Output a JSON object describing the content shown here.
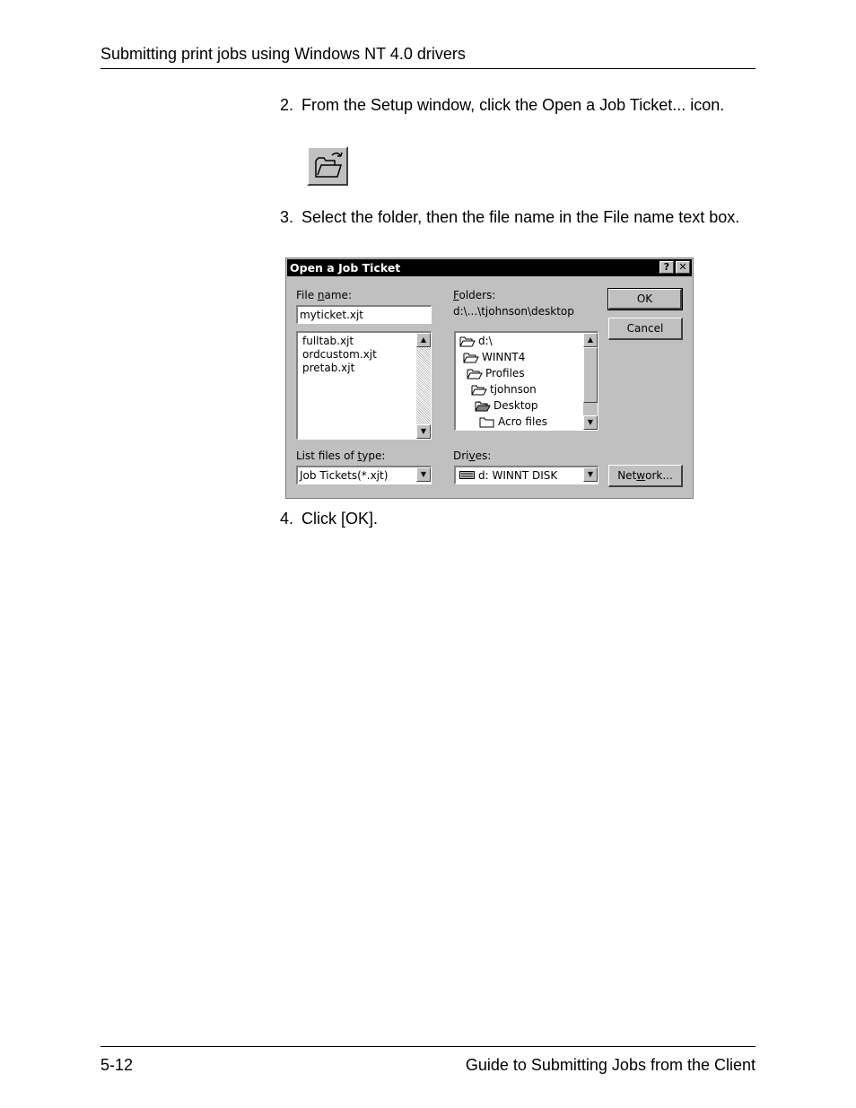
{
  "header": {
    "title": "Submitting print jobs using Windows NT 4.0 drivers"
  },
  "steps": [
    {
      "num": "2.",
      "text": "From the Setup window, click the Open a Job Ticket... icon."
    },
    {
      "num": "3.",
      "text": "Select the folder, then the file name in the File name text box."
    },
    {
      "num": "4.",
      "text": "Click [OK]."
    }
  ],
  "toolbar_icon": {
    "icon": "open-folder-icon"
  },
  "dialog": {
    "title": "Open a Job Ticket",
    "help_btn": "?",
    "close_btn": "✕",
    "file_name_label_pre": "File ",
    "file_name_label_u": "n",
    "file_name_label_post": "ame:",
    "file_name_value": "myticket.xjt",
    "files": [
      "fulltab.xjt",
      "ordcustom.xjt",
      "pretab.xjt"
    ],
    "folders_label_u": "F",
    "folders_label_post": "olders:",
    "current_path": "d:\\...\\tjohnson\\desktop",
    "folder_tree": [
      {
        "name": "d:\\",
        "icon": "open-folder-icon"
      },
      {
        "name": "WINNT4",
        "icon": "open-folder-icon"
      },
      {
        "name": "Profiles",
        "icon": "open-folder-icon"
      },
      {
        "name": "tjohnson",
        "icon": "open-folder-icon"
      },
      {
        "name": "Desktop",
        "icon": "open-folder-icon"
      },
      {
        "name": "Acro files",
        "icon": "closed-folder-icon"
      }
    ],
    "ok_label": "OK",
    "cancel_label": "Cancel",
    "list_type_label_pre": "List files of ",
    "list_type_label_u": "t",
    "list_type_label_post": "ype:",
    "list_type_value": "Job Tickets(*.xjt)",
    "drives_label_pre": "Dri",
    "drives_label_u": "v",
    "drives_label_post": "es:",
    "drives_value": "d: WINNT DISK",
    "network_label_pre": "Net",
    "network_label_u": "w",
    "network_label_post": "ork..."
  },
  "footer": {
    "page_number": "5-12",
    "guide_title": "Guide to Submitting Jobs from the Client"
  }
}
